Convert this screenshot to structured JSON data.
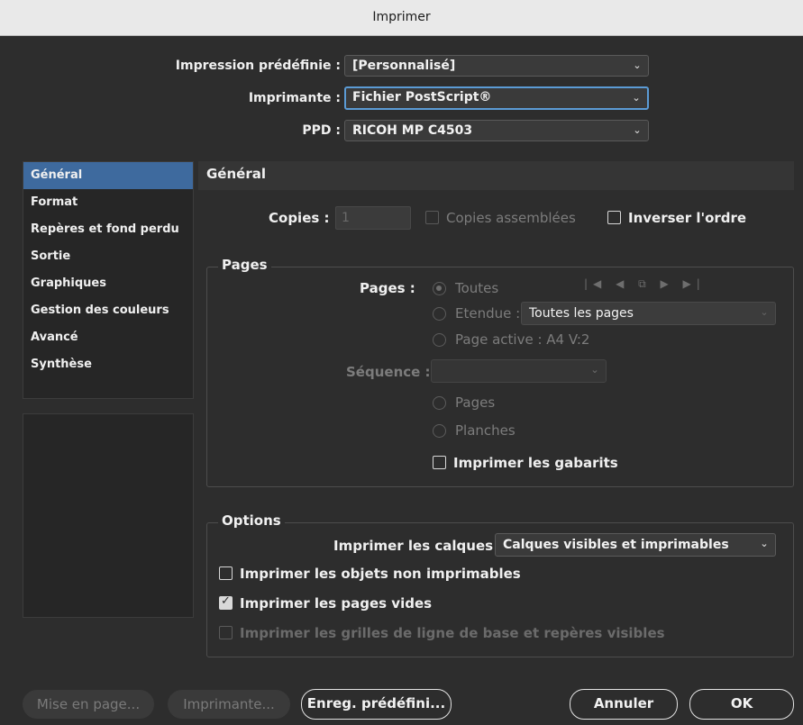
{
  "window": {
    "title": "Imprimer"
  },
  "top": {
    "preset_label": "Impression prédéfinie :",
    "preset_value": "[Personnalisé]",
    "printer_label": "Imprimante :",
    "printer_value": "Fichier PostScript®",
    "ppd_label": "PPD :",
    "ppd_value": "RICOH MP C4503"
  },
  "sidebar": {
    "items": [
      {
        "label": "Général"
      },
      {
        "label": "Format"
      },
      {
        "label": "Repères et fond perdu"
      },
      {
        "label": "Sortie"
      },
      {
        "label": "Graphiques"
      },
      {
        "label": "Gestion des couleurs"
      },
      {
        "label": "Avancé"
      },
      {
        "label": "Synthèse"
      }
    ],
    "active_index": 0
  },
  "general": {
    "title": "Général",
    "copies_label": "Copies :",
    "copies_value": "1",
    "collate_label": "Copies assemblées",
    "reverse_label": "Inverser l'ordre"
  },
  "pages": {
    "group_title": "Pages",
    "pages_label": "Pages :",
    "all_label": "Toutes",
    "range_label": "Etendue :",
    "range_value": "Toutes les pages",
    "active_label": "Page active : A4 V:2",
    "sequence_label": "Séquence :",
    "seq_pages_label": "Pages",
    "seq_spreads_label": "Planches",
    "print_masters_label": "Imprimer les gabarits",
    "nav_icons": "|◀ ◀ ⧉ ▶ ▶|"
  },
  "options": {
    "group_title": "Options",
    "layers_label": "Imprimer les calques :",
    "layers_value": "Calques visibles et imprimables",
    "nonprint_label": "Imprimer les objets non imprimables",
    "blank_pages_label": "Imprimer les pages vides",
    "grids_label": "Imprimer les grilles de ligne de base et repères visibles"
  },
  "buttons": {
    "page_setup": "Mise en page...",
    "printer": "Imprimante...",
    "save_preset": "Enreg. prédéfini...",
    "cancel": "Annuler",
    "ok": "OK"
  },
  "colors": {
    "accent": "#3e6a9e",
    "focus": "#5b9bd5"
  }
}
